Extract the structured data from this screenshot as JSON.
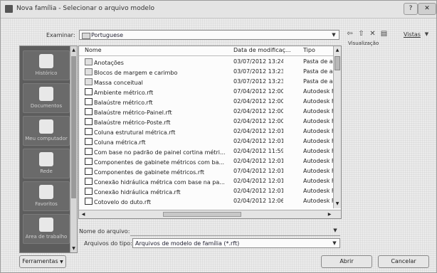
{
  "window": {
    "title": "Nova família - Selecionar o arquivo modelo",
    "help_label": "?",
    "close_label": "✕"
  },
  "toolbar": {
    "search_label": "Examinar:",
    "folder_value": "Portuguese",
    "views_label": "Vistas",
    "preview_label": "Visualização"
  },
  "places": [
    {
      "label": "Histórico"
    },
    {
      "label": "Documentos"
    },
    {
      "label": "Meu computador"
    },
    {
      "label": "Rede"
    },
    {
      "label": "Favoritos"
    },
    {
      "label": "Área de trabalho"
    }
  ],
  "list": {
    "columns": [
      "Nome",
      "Data de modificaç...",
      "Tipo"
    ],
    "rows": [
      {
        "name": "Anotações",
        "date": "03/07/2012 13:24",
        "type": "Pasta de ar",
        "icon": "folder"
      },
      {
        "name": "Blocos de margem e carimbo",
        "date": "03/07/2012 13:23",
        "type": "Pasta de ar",
        "icon": "folder"
      },
      {
        "name": "Massa conceitual",
        "date": "03/07/2012 13:23",
        "type": "Pasta de ar",
        "icon": "folder"
      },
      {
        "name": "Ambiente métrico.rft",
        "date": "07/04/2012 12:00",
        "type": "Autodesk F",
        "icon": "rft"
      },
      {
        "name": "Balaústre métrico.rft",
        "date": "02/04/2012 12:00",
        "type": "Autodesk F",
        "icon": "rft"
      },
      {
        "name": "Balaústre métrico-Painel.rft",
        "date": "02/04/2012 12:00",
        "type": "Autodesk F",
        "icon": "rft"
      },
      {
        "name": "Balaústre métrico-Poste.rft",
        "date": "02/04/2012 12:00",
        "type": "Autodesk F",
        "icon": "rft"
      },
      {
        "name": "Coluna estrutural métrica.rft",
        "date": "02/04/2012 12:01",
        "type": "Autodesk F",
        "icon": "rft"
      },
      {
        "name": "Coluna métrica.rft",
        "date": "02/04/2012 12:01",
        "type": "Autodesk F",
        "icon": "rft"
      },
      {
        "name": "Com base no padrão de painel cortina métri...",
        "date": "02/04/2012 11:59",
        "type": "Autodesk F",
        "icon": "rft"
      },
      {
        "name": "Componentes de gabinete métricos com ba...",
        "date": "02/04/2012 12:01",
        "type": "Autodesk F",
        "icon": "rft"
      },
      {
        "name": "Componentes de gabinete métricos.rft",
        "date": "07/04/2012 12:01",
        "type": "Autodesk F",
        "icon": "rft"
      },
      {
        "name": "Conexão hidráulica métrica com base na pa...",
        "date": "02/04/2012 12:01",
        "type": "Autodesk F",
        "icon": "rft"
      },
      {
        "name": "Conexão hidráulica métrica.rft",
        "date": "02/04/2012 12:01",
        "type": "Autodesk F",
        "icon": "rft"
      },
      {
        "name": "Cotovelo do duto.rft",
        "date": "02/04/2012 12:06",
        "type": "Autodesk F",
        "icon": "rft"
      }
    ]
  },
  "bottom": {
    "filename_label": "Nome do arquivo:",
    "filename_value": "",
    "filetype_label": "Arquivos do tipo:",
    "filetype_value": "Arquivos de modelo de família (*.rft)",
    "tools_label": "Ferramentas",
    "open_label": "Abrir",
    "cancel_label": "Cancelar"
  }
}
